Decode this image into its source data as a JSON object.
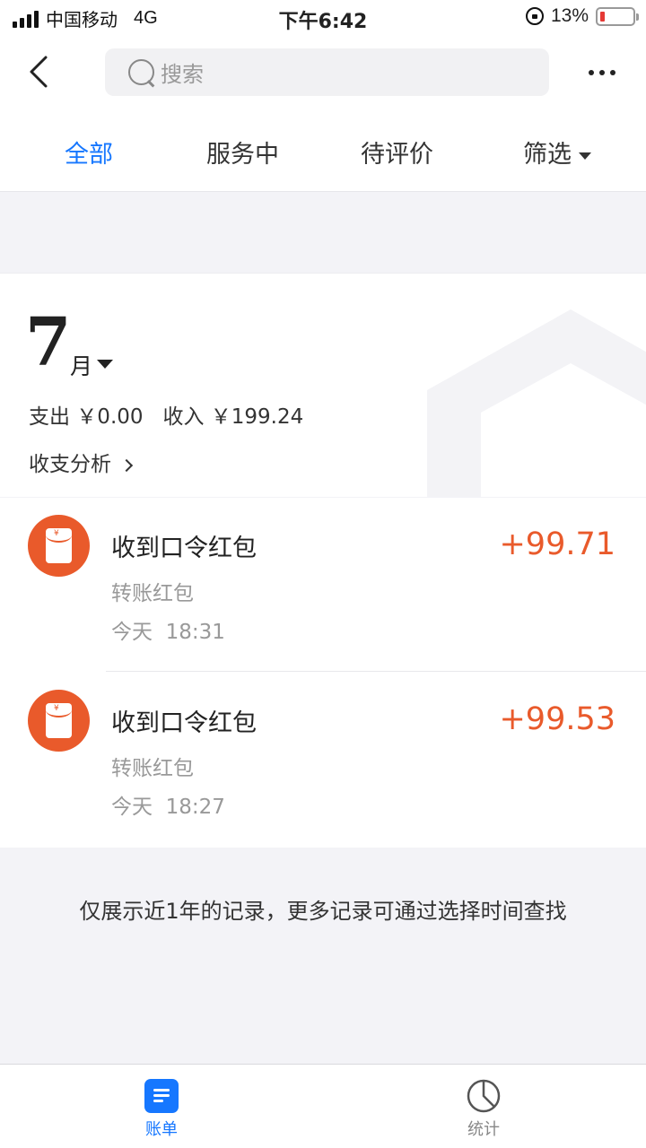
{
  "status_bar": {
    "carrier": "中国移动",
    "network": "4G",
    "time": "下午6:42",
    "battery": "13%"
  },
  "search": {
    "placeholder": "搜索"
  },
  "tabs": [
    {
      "label": "全部",
      "active": true
    },
    {
      "label": "服务中",
      "active": false
    },
    {
      "label": "待评价",
      "active": false
    },
    {
      "label": "筛选",
      "active": false
    }
  ],
  "summary": {
    "month": "7",
    "month_unit": "月",
    "totals": "支出 ￥0.00   收入 ￥199.24",
    "analysis_link": "收支分析"
  },
  "records": [
    {
      "title": "收到口令红包",
      "subtitle": "转账红包",
      "time": "今天  18:31",
      "amount": "+99.71"
    },
    {
      "title": "收到口令红包",
      "subtitle": "转账红包",
      "time": "今天  18:27",
      "amount": "+99.53"
    }
  ],
  "footer_note": "仅展示近1年的记录，更多记录可通过选择时间查找",
  "bottom_tabs": [
    {
      "label": "账单",
      "active": true
    },
    {
      "label": "统计",
      "active": false
    }
  ],
  "colors": {
    "accent": "#1677ff",
    "income": "#e95a2b",
    "background": "#f3f3f7"
  }
}
